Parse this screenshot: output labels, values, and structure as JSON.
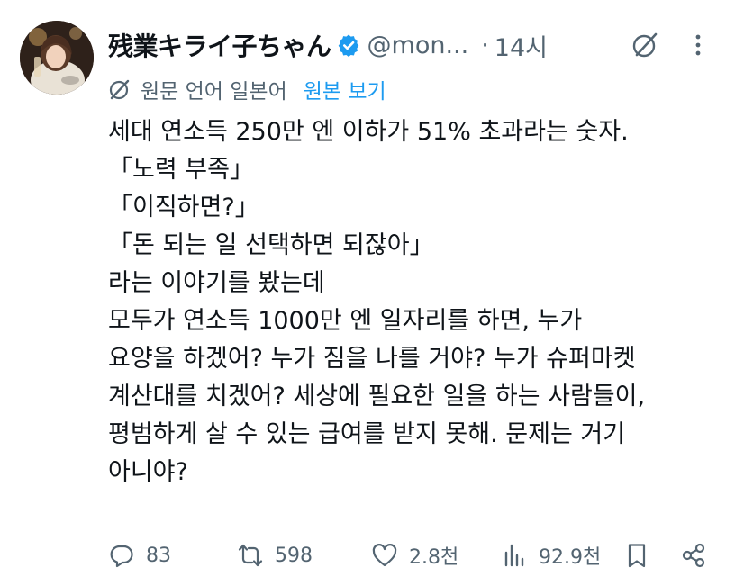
{
  "author": {
    "display_name": "残業キライ子ちゃん",
    "handle": "@mon...",
    "time": "14시"
  },
  "translation": {
    "label": "원문 언어 일본어",
    "link": "원본 보기"
  },
  "body_lines": [
    "세대 연소득 250만 엔 이하가 51% 초과라는 숫자.",
    "「노력 부족」",
    "「이직하면?」",
    "「돈 되는 일 선택하면 되잖아」",
    "라는 이야기를 봤는데",
    "모두가 연소득 1000만 엔 일자리를 하면, 누가",
    "요양을 하겠어? 누가 짐을 나를 거야? 누가 슈퍼마켓",
    "계산대를 치겠어? 세상에 필요한 일을 하는 사람들이,",
    "평범하게 살 수 있는 급여를 받지 못해. 문제는 거기",
    "아니야?"
  ],
  "stats": {
    "replies": "83",
    "reposts": "598",
    "likes": "2.8천",
    "views": "92.9천"
  },
  "icons": {
    "verified": "verified-badge-icon",
    "grok": "grok-icon",
    "more": "more-icon",
    "translate": "translate-icon",
    "reply": "reply-icon",
    "repost": "repost-icon",
    "like": "like-icon",
    "views": "views-icon",
    "bookmark": "bookmark-icon",
    "share": "share-icon"
  },
  "colors": {
    "accent": "#1d9bf0",
    "text": "#0f1419",
    "secondary": "#536471"
  }
}
